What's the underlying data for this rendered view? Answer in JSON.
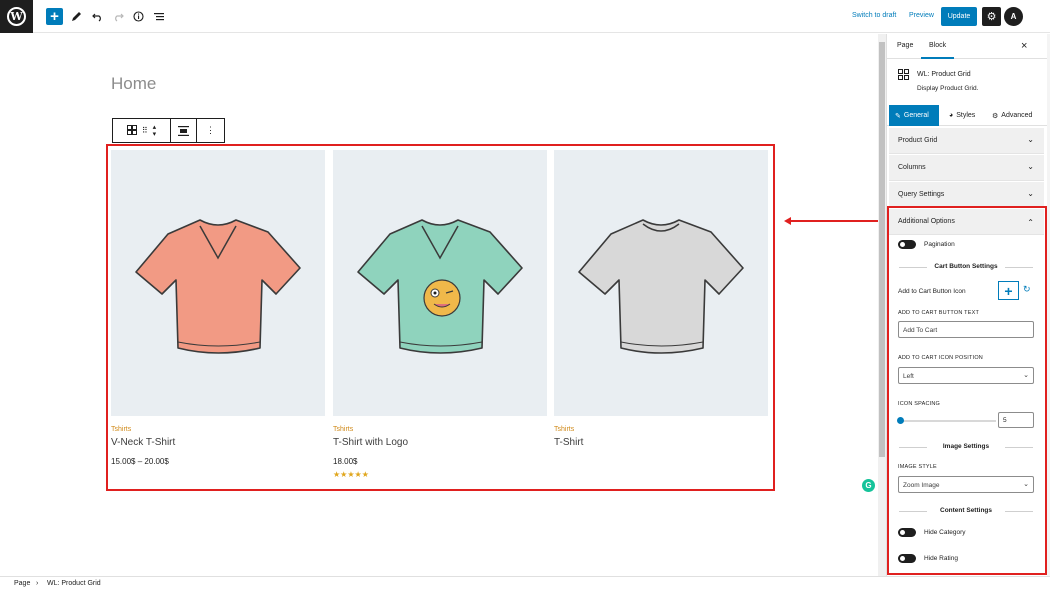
{
  "topbar": {
    "add_block_label": "+",
    "switch_to_draft": "Switch to draft",
    "preview": "Preview",
    "update": "Update",
    "plugin_label": "A"
  },
  "canvas": {
    "page_title": "Home",
    "products": [
      {
        "category": "Tshirts",
        "name": "V-Neck T-Shirt",
        "price": "15.00$ – 20.00$",
        "stars": "",
        "shirt_color": "#f29a84",
        "neck": "v",
        "logo": false
      },
      {
        "category": "Tshirts",
        "name": "T-Shirt with Logo",
        "price": "18.00$",
        "stars": "★★★★★",
        "shirt_color": "#8fd3bd",
        "neck": "v",
        "logo": true
      },
      {
        "category": "Tshirts",
        "name": "T-Shirt",
        "price": "",
        "stars": "",
        "shirt_color": "#d8d8d8",
        "neck": "round",
        "logo": false
      }
    ]
  },
  "sidebar": {
    "tabs": [
      "Page",
      "Block"
    ],
    "close_label": "×",
    "block_name": "WL: Product Grid",
    "block_desc": "Display Product Grid.",
    "style_tabs": [
      "General",
      "Styles",
      "Advanced"
    ],
    "accordions": [
      "Product Grid",
      "Columns",
      "Query Settings",
      "Additional Options"
    ],
    "pagination_label": "Pagination",
    "cart_button_settings": "Cart Button Settings",
    "add_to_cart_icon_label": "Add to Cart Button Icon",
    "add_to_cart_text_label": "ADD TO CART BUTTON TEXT",
    "add_to_cart_text_value": "Add To Cart",
    "icon_position_label": "ADD TO CART ICON POSITION",
    "icon_position_value": "Left",
    "icon_spacing_label": "ICON SPACING",
    "icon_spacing_value": "5",
    "image_settings": "Image Settings",
    "image_style_label": "IMAGE STYLE",
    "image_style_value": "Zoom Image",
    "content_settings": "Content Settings",
    "hide_category": "Hide Category",
    "hide_rating": "Hide Rating"
  },
  "footer": {
    "crumb_page": "Page",
    "crumb_block": "WL: Product Grid"
  },
  "colors": {
    "accent": "#007cba",
    "highlight": "#e0201f",
    "category": "#d08a1a"
  }
}
